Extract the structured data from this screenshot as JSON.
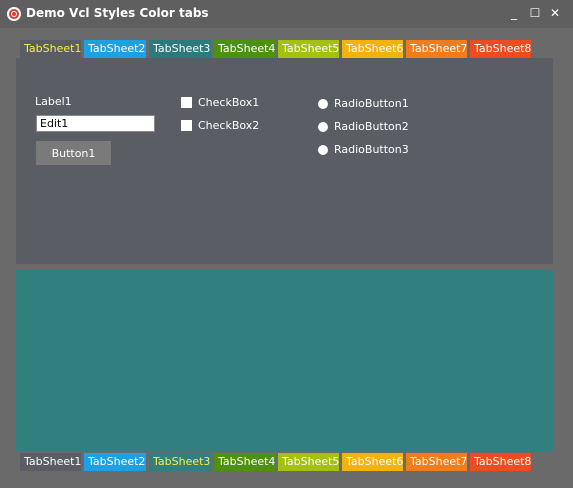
{
  "window": {
    "title": "Demo Vcl Styles Color tabs",
    "buttons": {
      "minimize": "_",
      "maximize": "☐",
      "close": "✕"
    }
  },
  "top_tabs": [
    {
      "label": "TabSheet1"
    },
    {
      "label": "TabSheet2"
    },
    {
      "label": "TabSheet3"
    },
    {
      "label": "TabSheet4"
    },
    {
      "label": "TabSheet5"
    },
    {
      "label": "TabSheet6"
    },
    {
      "label": "TabSheet7"
    },
    {
      "label": "TabSheet8"
    }
  ],
  "bottom_tabs": [
    {
      "label": "TabSheet1"
    },
    {
      "label": "TabSheet2"
    },
    {
      "label": "TabSheet3"
    },
    {
      "label": "TabSheet4"
    },
    {
      "label": "TabSheet5"
    },
    {
      "label": "TabSheet6"
    },
    {
      "label": "TabSheet7"
    },
    {
      "label": "TabSheet8"
    }
  ],
  "form": {
    "label1": "Label1",
    "edit1_value": "Edit1",
    "button1": "Button1",
    "checkboxes": [
      "CheckBox1",
      "CheckBox2"
    ],
    "radios": [
      "RadioButton1",
      "RadioButton2",
      "RadioButton3"
    ]
  },
  "colors": {
    "tab_active_text": "#f6f04a",
    "tab2": "#1da1e5",
    "tab3": "#2c7a7c",
    "tab4": "#4c9110",
    "tab5": "#a3c10e",
    "tab6": "#f4b20c",
    "tab7": "#f07d1a",
    "tab8": "#ee4b1f"
  }
}
